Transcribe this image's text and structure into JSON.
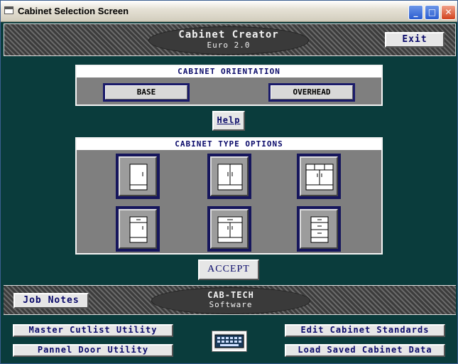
{
  "window": {
    "title": "Cabinet Selection Screen"
  },
  "header": {
    "app_name": "Cabinet Creator",
    "version": "Euro 2.0",
    "exit_label": "Exit"
  },
  "orientation": {
    "heading": "CABINET ORIENTATION",
    "base_label": "BASE",
    "overhead_label": "OVERHEAD"
  },
  "help_label": "Help",
  "type_options": {
    "heading": "CABINET TYPE OPTIONS"
  },
  "accept_label": "ACCEPT",
  "footer": {
    "job_notes_label": "Job Notes",
    "company_line1": "CAB-TECH",
    "company_line2": "Software",
    "master_cutlist_label": "Master Cutlist Utility",
    "panel_door_label": "Pannel Door Utility",
    "edit_standards_label": "Edit Cabinet Standards",
    "load_saved_label": "Load Saved Cabinet Data"
  },
  "icons": {
    "window": "app-window-icon",
    "minimize": "minimize-icon",
    "maximize": "maximize-icon",
    "close": "close-icon",
    "keyboard": "keyboard-icon"
  },
  "colors": {
    "background": "#0a3c3c",
    "button_text": "#0a0a6a",
    "oval": "#3a3a3a"
  }
}
